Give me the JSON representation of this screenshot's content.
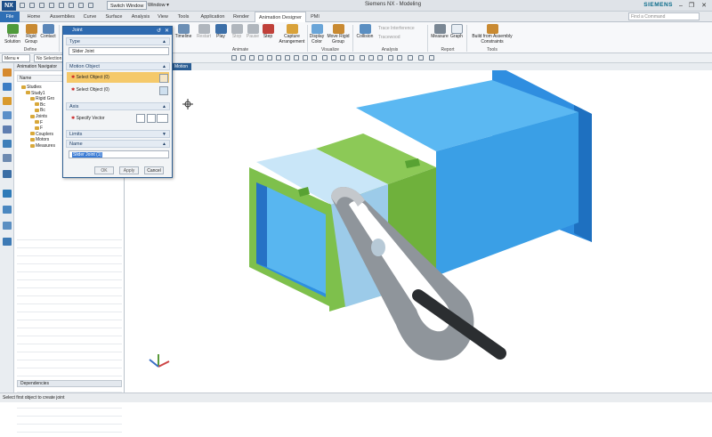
{
  "app": {
    "logo": "NX",
    "title": "Siemens NX - Modeling",
    "brand": "SIEMENS",
    "switch_window": "Switch Window",
    "window_menu": "Window ▾",
    "find_command_placeholder": "Find a Command",
    "colors": {
      "file_tab": "#2f6fb5",
      "title_bar": "#2e6ab0",
      "highlight_row": "#f5c96a",
      "part_blue": "#3aa0e8",
      "part_green": "#7ec04c"
    }
  },
  "tabs": [
    "File",
    "Home",
    "Assemblies",
    "Curve",
    "Surface",
    "Analysis",
    "View",
    "Tools",
    "Application",
    "Render",
    "Animation Designer",
    "PMI"
  ],
  "active_tab": "Animation Designer",
  "ribbon": {
    "groups": [
      {
        "label": "Define",
        "buttons": [
          "New Solution",
          "Rigid Group",
          "Contact"
        ]
      },
      {
        "label": "Animate",
        "buttons": [
          "Timeline",
          "Restart",
          "Play",
          "Stop",
          "Pause",
          "Step",
          "Capture Arrangement"
        ]
      },
      {
        "label": "Visualize",
        "buttons": [
          "Display Color",
          "Move Rigid Group"
        ]
      },
      {
        "label": "Analysis",
        "buttons": [
          "Collision",
          "Trace Interference",
          "Tracewood"
        ]
      },
      {
        "label": "Report",
        "buttons": [
          "Measure",
          "Graph"
        ]
      },
      {
        "label": "Tools",
        "buttons": [
          "Build from Assembly Constraints"
        ]
      }
    ]
  },
  "cmdbar": {
    "menu": "Menu ▾",
    "selection_filter": "No Selection Filter"
  },
  "graphics_tab": "Motion",
  "navigator": {
    "title": "Animation Navigator",
    "column": "Name",
    "tree": [
      {
        "indent": 1,
        "label": "Studies"
      },
      {
        "indent": 2,
        "label": "Study1"
      },
      {
        "indent": 3,
        "label": "Rigid Gro"
      },
      {
        "indent": 4,
        "label": "Bc"
      },
      {
        "indent": 4,
        "label": "Bc"
      },
      {
        "indent": 3,
        "label": "Joints"
      },
      {
        "indent": 4,
        "label": "F"
      },
      {
        "indent": 4,
        "label": "F"
      },
      {
        "indent": 3,
        "label": "Couplers"
      },
      {
        "indent": 3,
        "label": "Motors"
      },
      {
        "indent": 3,
        "label": "Measures"
      }
    ],
    "dependencies": "Dependencies"
  },
  "dialog": {
    "title": "Joint",
    "type_section": "Type",
    "type_value": "Slider Joint",
    "motion_section": "Motion Object",
    "select_object_1": "Select Object (0)",
    "select_object_2": "Select Object (0)",
    "axis_section": "Axis",
    "specify_vector": "Specify Vector",
    "limits_section": "Limits",
    "name_section": "Name",
    "name_value": "Slider Joint (1)",
    "ok": "OK",
    "apply": "Apply",
    "cancel": "Cancel"
  },
  "status": "Select first object to create joint"
}
